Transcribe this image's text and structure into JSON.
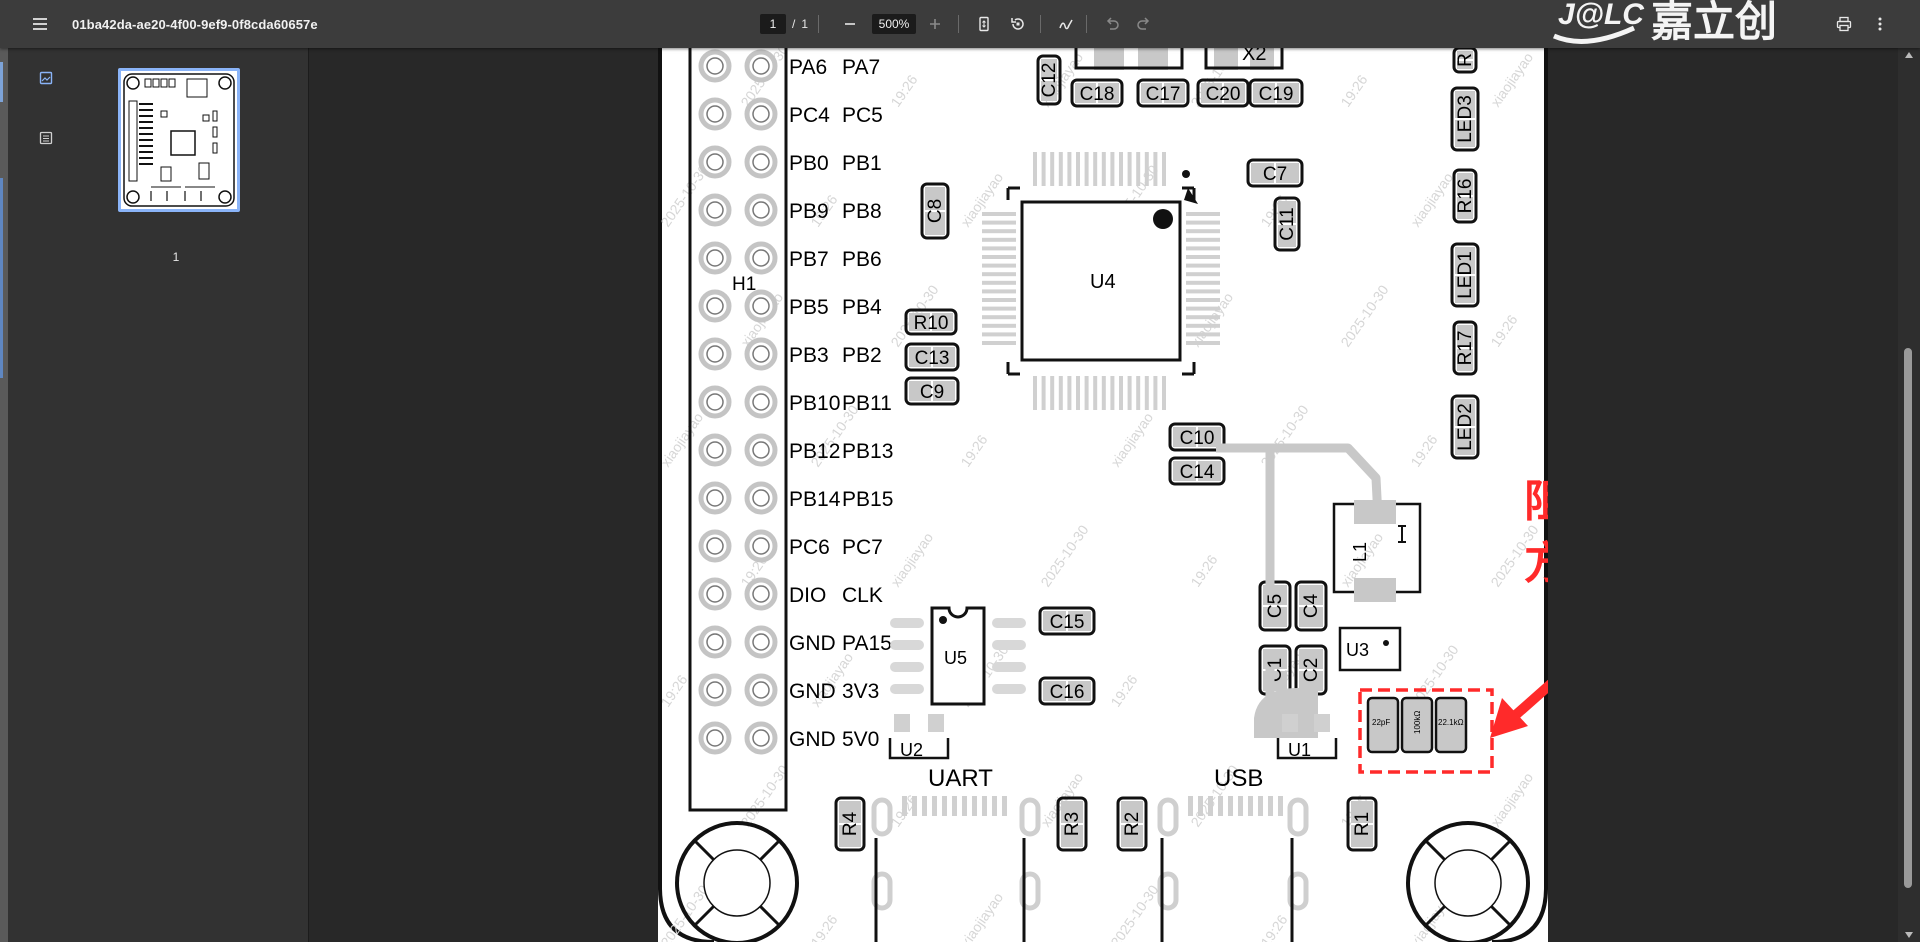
{
  "toolbar": {
    "filename": "01ba42da-ae20-4f00-9ef9-0f8cda60657e",
    "page_current": "1",
    "page_separator": "/",
    "page_total": "1",
    "zoom_value": "500%",
    "icons": [
      "menu-icon",
      "zoom-out-icon",
      "zoom-in-icon",
      "fit-page-icon",
      "rotate-icon",
      "annotate-icon",
      "undo-icon",
      "redo-icon",
      "print-icon",
      "more-vert-icon"
    ]
  },
  "sidebar": {
    "thumbnail_label": "1",
    "icons": [
      "thumbnail-view-icon",
      "outline-view-icon"
    ]
  },
  "logo": {
    "mark": "J@LC",
    "name": "嘉立创"
  },
  "watermark": {
    "user": "xiaojiayao",
    "date": "2025-10-30",
    "time": "19:26"
  },
  "pcb": {
    "header_label": "H1",
    "pin_labels": [
      [
        "PA6",
        "PA7"
      ],
      [
        "PC4",
        "PC5"
      ],
      [
        "PB0",
        "PB1"
      ],
      [
        "PB9",
        "PB8"
      ],
      [
        "PB7",
        "PB6"
      ],
      [
        "PB5",
        "PB4"
      ],
      [
        "PB3",
        "PB2"
      ],
      [
        "PB10",
        "PB11"
      ],
      [
        "PB12",
        "PB13"
      ],
      [
        "PB14",
        "PB15"
      ],
      [
        "PC6",
        "PC7"
      ],
      [
        "DIO",
        "CLK"
      ],
      [
        "GND",
        "PA15"
      ],
      [
        "GND",
        "3V3"
      ],
      [
        "GND",
        "5V0"
      ]
    ],
    "parts": {
      "u4": "U4",
      "u5": "U5",
      "u1": "U1",
      "u2": "U2",
      "u3": "U3",
      "l1": "L1",
      "x2": "X2",
      "c12": "C12",
      "c18": "C18",
      "c17": "C17",
      "c20": "C20",
      "c19": "C19",
      "c7": "C7",
      "c11": "C11",
      "c8": "C8",
      "r10": "R10",
      "c13": "C13",
      "c9": "C9",
      "c10": "C10",
      "c14": "C14",
      "c15": "C15",
      "c16": "C16",
      "c5": "C5",
      "c4": "C4",
      "c1": "C1",
      "c2": "C2",
      "r_top": "R",
      "led3": "LED3",
      "r16": "R16",
      "led1": "LED1",
      "r17": "R17",
      "led2": "LED2",
      "r4": "R4",
      "r3": "R3",
      "r2": "R2",
      "r1": "R1"
    },
    "connectors": {
      "uart": "UART",
      "usb": "USB"
    },
    "pad_values": [
      "22pF",
      "100kΩ",
      "22.1kΩ"
    ],
    "annotation": {
      "line1": "阻值居中显示",
      "line2": "方便焊接",
      "color": "#ff2a2a"
    }
  }
}
